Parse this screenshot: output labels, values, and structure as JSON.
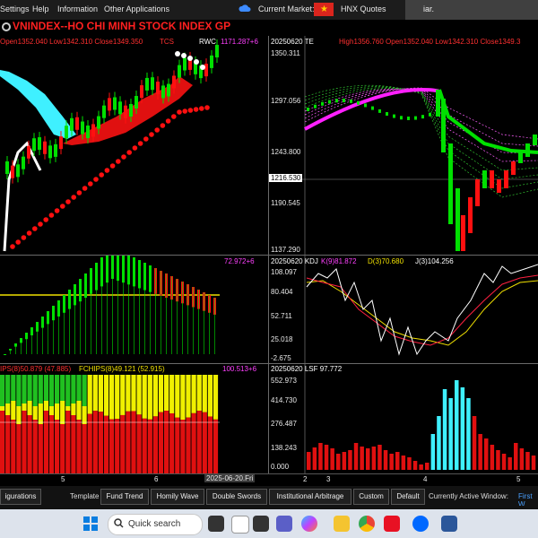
{
  "menu": [
    "Settings",
    "Help",
    "Information",
    "Other Applications"
  ],
  "current_market": {
    "label": "Current Market:",
    "market": "HNX Quotes"
  },
  "announcement": "iar.",
  "top_left": {
    "title": "VNINDEX--HO CHI MINH STOCK INDEX  GP",
    "ohlc": "Open1352.040 Low1342.310 Close1349.350",
    "tag1": "TCS",
    "tag2": "RWC",
    "value": "1171.287+6"
  },
  "top_right": {
    "title": "20250620 TE",
    "ohlc": "High1356.760 Open1352.040 Low1342.310 Close1349.3",
    "y_labels": [
      "1350.311",
      "1297.056",
      "1243.800",
      "1216.530",
      "1190.545",
      "1137.290"
    ]
  },
  "mid_left": {
    "value": "72.972+6"
  },
  "mid_right": {
    "date": "20250620 KDJ",
    "k": "K(9)81.872",
    "d": "D(3)70.680",
    "j": "J(3)104.256",
    "y_labels": [
      "108.097",
      "80.404",
      "52.711",
      "25.018",
      "-2.675"
    ]
  },
  "bot_left": {
    "a": "IPS(8)50.879 (47.885)",
    "b": "FCHIPS(8)49.121 (52.915)",
    "value": "100.513+6"
  },
  "bot_right": {
    "title": "20250620 LSF 97.772",
    "y_labels": [
      "552.973",
      "414.730",
      "276.487",
      "138.243",
      "0.000"
    ]
  },
  "x_axis_left": [
    "5",
    "6"
  ],
  "x_axis_date": "2025-06-20.Fri",
  "x_axis_right": [
    "2",
    "3",
    "4",
    "5"
  ],
  "template_bar": {
    "config": "igurations",
    "label": "Template",
    "buttons": [
      "Fund Trend",
      "Homily Wave",
      "Double Swords",
      "Institutional Arbitrage",
      "Custom",
      "Default"
    ],
    "active": "Currently Active Window:",
    "active_value": "First W"
  },
  "taskbar": {
    "search": "Quick search"
  },
  "colors": {
    "up": "#00e000",
    "down": "#ff1010",
    "cloud": "#3ff0ff",
    "kline": "#ff00ff",
    "yellow": "#f0e000"
  }
}
